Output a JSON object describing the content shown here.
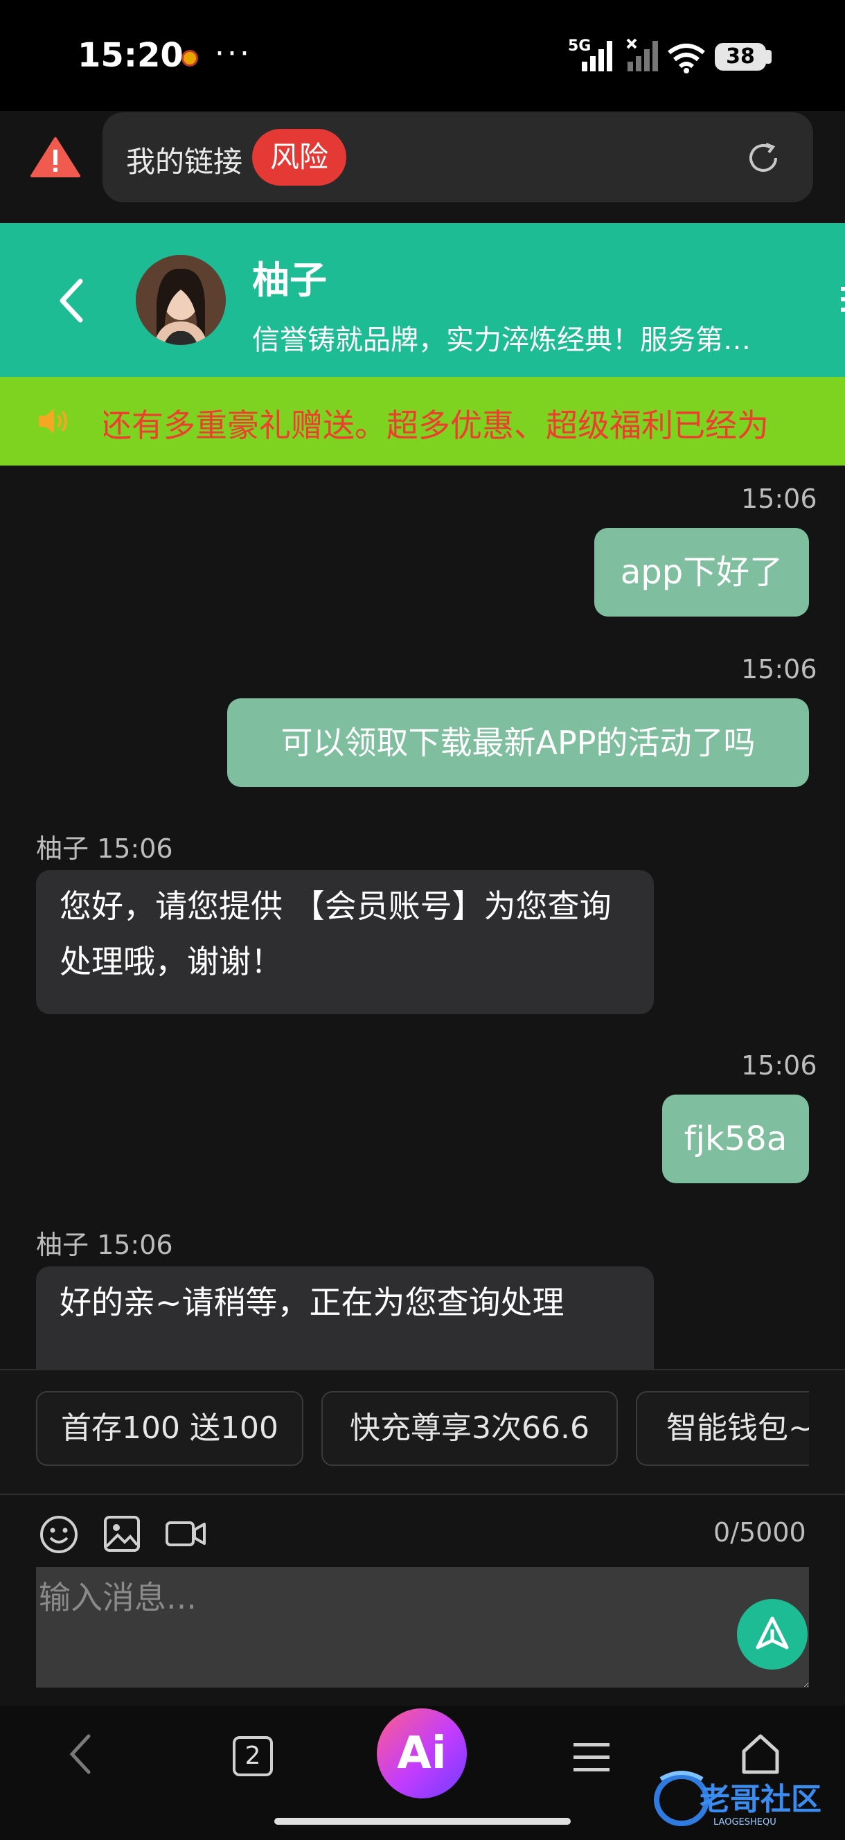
{
  "status": {
    "time": "15:20",
    "dots": "···",
    "network": "5G",
    "battery": "38"
  },
  "address_bar": {
    "text": "我的链接",
    "risk_badge": "风险"
  },
  "chat_header": {
    "name": "柚子",
    "slogan": "信誉铸就品牌，实力淬炼经典！服务第…"
  },
  "marquee": {
    "text": "还有多重豪礼赠送。超多优惠、超级福利已经为"
  },
  "messages": [
    {
      "time": "15:06",
      "text": "app下好了"
    },
    {
      "time": "15:06",
      "text": "可以领取下载最新APP的活动了吗"
    },
    {
      "meta": "柚子 15:06",
      "text": "您好，请您提供 【会员账号】为您查询处理哦，谢谢！"
    },
    {
      "time": "15:06",
      "text": "fjk58a"
    },
    {
      "meta": "柚子 15:06",
      "text": "好的亲~请稍等，正在为您查询处理"
    }
  ],
  "quick_replies": [
    "首存100 送100",
    "快充尊享3次66.6",
    "智能钱包~"
  ],
  "input": {
    "placeholder": "输入消息...",
    "char_count": "0/5000"
  },
  "nav": {
    "tabs_count": "2",
    "ai_label": "Ai"
  },
  "watermark": {
    "text": "老哥社区",
    "sub": "LAOGESHEQU"
  },
  "colors": {
    "header_green": "#1ebc94",
    "marquee_bg": "#7ed321",
    "marquee_text": "#ef3e2f",
    "out_bubble": "#7fbf9f",
    "in_bubble": "#2e2e30",
    "risk_red": "#e53935"
  },
  "icons": [
    "warning-icon",
    "refresh-icon",
    "back-icon",
    "speaker-icon",
    "emoji-icon",
    "image-icon",
    "video-icon",
    "send-icon",
    "home-icon",
    "menu-icon"
  ]
}
